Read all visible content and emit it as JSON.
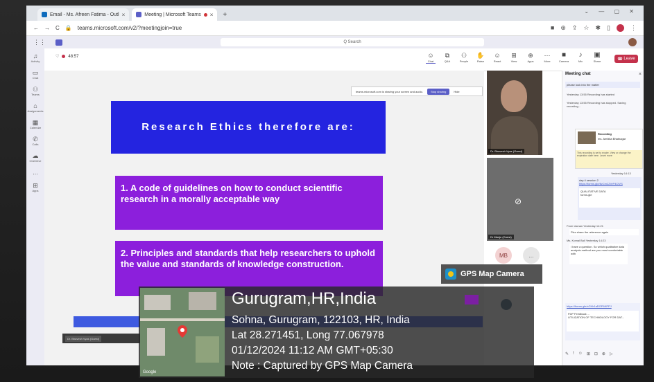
{
  "browser": {
    "tabs": [
      {
        "label": "Email - Ms. Afreen Fatima - Outl",
        "active": false
      },
      {
        "label": "Meeting | Microsoft Teams",
        "active": true
      }
    ],
    "new_tab": "+",
    "url": "teams.microsoft.com/v2/?meetingjoin=true"
  },
  "teams": {
    "search_placeholder": "Q Search",
    "rail": [
      "Activity",
      "Chat",
      "Teams",
      "Assignments",
      "Calendar",
      "Calls",
      "OneDrive",
      "...",
      "Apps"
    ],
    "timer": "48:57",
    "controls": [
      "Chat",
      "Q&A",
      "People",
      "Raise",
      "React",
      "View",
      "Apps",
      "More",
      "Camera",
      "Mic",
      "Share"
    ],
    "leave_label": "Leave"
  },
  "share": {
    "notice": "teams.microsoft.com is sharing your screen and audio.",
    "stop_label": "Stop sharing",
    "hide_label": "Hide"
  },
  "slide": {
    "title": "Research Ethics therefore are:",
    "point1": "1. A code of guidelines on how to conduct scientific research in a morally acceptable way",
    "point2": "2. Principles and standards that help researchers to uphold the value and standards of knowledge construction."
  },
  "participants": {
    "video1_label": "Dr. Bhavesh Vyas (Guest)",
    "video2_label": "Dr Manju (Guest)",
    "initials": "MB",
    "more": "...",
    "bottom_label": "Dr. Bhavesh Vyas (Guest)"
  },
  "chat": {
    "title": "Meeting chat",
    "close": "×",
    "msg_top": "please look into the matter",
    "sys1": "Yesterday 13:55  Recording has started",
    "sys2": "Yesterday 13:55  Recording has stopped. Saving recording...",
    "recording_title": "Recording",
    "recording_sub": "ms. Ambika Bhatnagar",
    "recording_note": "This recording is set to expire. View or change the expiration date here. Learn more",
    "time1": "Yesterday 14:13",
    "msg_day": "day 4 session 2",
    "link1": "https://forms.gle/8vCm2ZVrP4CfVS",
    "card_title": "QUALITATIVE DATA",
    "card_sub": "forms.gle",
    "from1": "From Usman  Yesterday 14:21",
    "msg_ref": "Plzz share the reference again",
    "from2": "Ms. Komal Bali  Yesterday 14:23",
    "msg_q": "I have a question. So which qualitative data analysis method are you most comfortable with",
    "link2": "https://forms.gle/xCKh1aDGP6KPPJ",
    "card2_title": "FDP Feedback ...",
    "card2_sub": "UTILIZATION OF TECHNOLOGY FOR DAT..."
  },
  "gps": {
    "badge": "GPS Map Camera",
    "place": "Gurugram,HR,India",
    "address": "Sohna, Gurugram, 122103, HR, India",
    "latlong": "Lat 28.271451, Long 77.067978",
    "datetime": "01/12/2024 11:12 AM GMT+05:30",
    "note": "Note : Captured by GPS Map Camera",
    "map_brand": "Google"
  },
  "colors": {
    "teams_purple": "#5b5fc7",
    "leave_red": "#c4314b",
    "slide_blue": "#2424e0",
    "slide_purple": "#8c1fdc"
  }
}
